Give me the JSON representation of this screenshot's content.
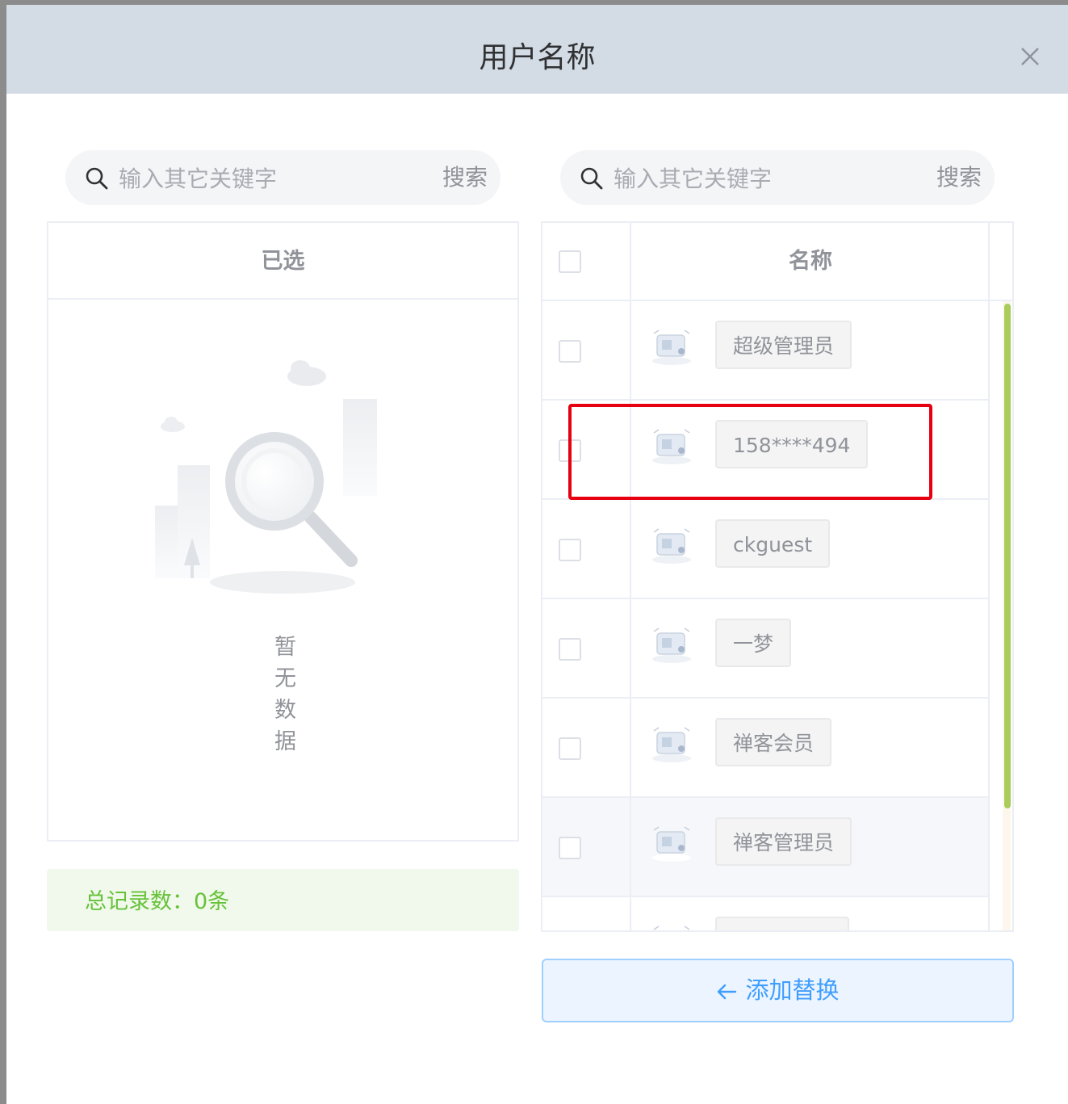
{
  "dialog": {
    "title": "用户名称"
  },
  "left_search": {
    "placeholder": "输入其它关键字",
    "button": "搜索"
  },
  "right_search": {
    "placeholder": "输入其它关键字",
    "button": "搜索"
  },
  "left_panel": {
    "header": "已选",
    "empty_text": "暂无数据",
    "total_label": "总记录数：0条"
  },
  "right_panel": {
    "header": "名称",
    "rows": [
      {
        "name": "超级管理员"
      },
      {
        "name": "158****494"
      },
      {
        "name": "ckguest"
      },
      {
        "name": "一梦"
      },
      {
        "name": "禅客会员"
      },
      {
        "name": "禅客管理员"
      },
      {
        "name": ""
      }
    ]
  },
  "add_button": {
    "label": "添加替换"
  },
  "colors": {
    "header_bg": "#d3dbe5",
    "success": "#67c23a",
    "primary": "#409eff",
    "highlight": "#e60012",
    "scrollbar": "#a9cc5a"
  },
  "icons": [
    "close-icon",
    "search-icon",
    "empty-data-illustration",
    "user-avatar-icon",
    "arrow-left-icon"
  ]
}
